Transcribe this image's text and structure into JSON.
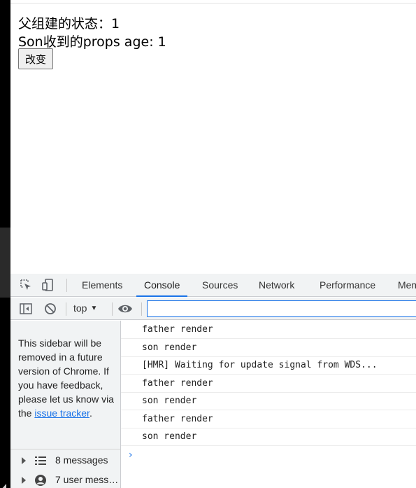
{
  "page": {
    "parent_state_line": "父组建的状态：1",
    "son_props_line": "Son收到的props age: 1",
    "change_button_label": "改变"
  },
  "devtools": {
    "tabs": [
      "Elements",
      "Console",
      "Sources",
      "Network",
      "Performance",
      "Mem"
    ],
    "active_tab": "Console",
    "toolbar": {
      "context": "top",
      "filter_placeholder": ""
    },
    "sidebar": {
      "notice_text": "This sidebar will be removed in a future version of Chrome. If you have feedback, please let us know via the",
      "notice_link": "issue tracker",
      "notice_end": ".",
      "items": [
        {
          "icon": "list-icon",
          "label": "8 messages"
        },
        {
          "icon": "user-icon",
          "label": "7 user mess…"
        }
      ]
    },
    "console_logs": [
      "father render",
      "son render",
      "[HMR] Waiting for update signal from WDS...",
      "father render",
      "son render",
      "father render",
      "son render"
    ],
    "colors": {
      "accent": "#1a73e8",
      "panel_bg": "#f1f3f4",
      "border": "#cbcdd1"
    }
  }
}
